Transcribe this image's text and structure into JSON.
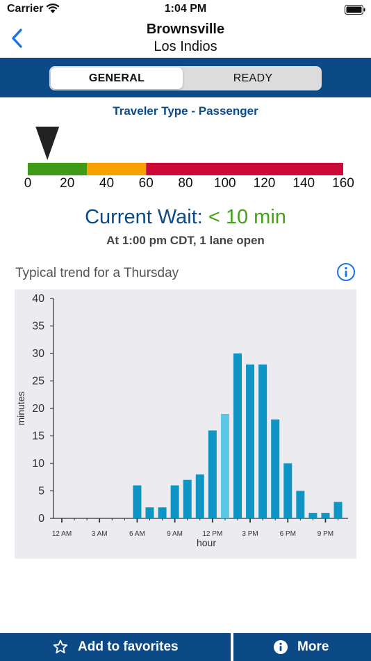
{
  "status_bar": {
    "carrier": "Carrier",
    "time": "1:04 PM"
  },
  "nav": {
    "title": "Brownsville",
    "subtitle": "Los Indios",
    "back_icon": "chevron-left-icon"
  },
  "tabs": [
    {
      "label": "GENERAL",
      "selected": true
    },
    {
      "label": "READY",
      "selected": false
    }
  ],
  "traveler_type": "Traveler Type - Passenger",
  "gauge": {
    "min": 0,
    "max": 160,
    "ticks": [
      "0",
      "20",
      "40",
      "60",
      "80",
      "100",
      "120",
      "140",
      "160"
    ],
    "pointer_value": 5,
    "segments": [
      {
        "from": 0,
        "to": 30,
        "color": "#3f9a17"
      },
      {
        "from": 30,
        "to": 60,
        "color": "#f7a100"
      },
      {
        "from": 60,
        "to": 160,
        "color": "#cc0a37"
      }
    ]
  },
  "current_wait": {
    "label": "Current Wait:",
    "value": "< 10 min"
  },
  "wait_detail": "At 1:00 pm CDT, 1 lane open",
  "trend_title": "Typical trend for a Thursday",
  "colors": {
    "brand": "#0c4a87",
    "bar": "#0f95c4",
    "bar_current": "#5bc6e6",
    "wait_value": "#43a219"
  },
  "chart_data": {
    "type": "bar",
    "xlabel": "hour",
    "ylabel": "minutes",
    "ylim": [
      0,
      40
    ],
    "yticks": [
      0,
      5,
      10,
      15,
      20,
      25,
      30,
      35,
      40
    ],
    "x_tick_labels": [
      {
        "hour": 0,
        "label": "12 AM"
      },
      {
        "hour": 3,
        "label": "3 AM"
      },
      {
        "hour": 6,
        "label": "6 AM"
      },
      {
        "hour": 9,
        "label": "9 AM"
      },
      {
        "hour": 12,
        "label": "12 PM"
      },
      {
        "hour": 15,
        "label": "3 PM"
      },
      {
        "hour": 18,
        "label": "6 PM"
      },
      {
        "hour": 21,
        "label": "9 PM"
      }
    ],
    "hours": [
      6,
      7,
      8,
      9,
      10,
      11,
      12,
      13,
      14,
      15,
      16,
      17,
      18,
      19,
      20,
      21,
      22
    ],
    "values": [
      6,
      2,
      2,
      6,
      7,
      8,
      16,
      19,
      30,
      28,
      28,
      18,
      10,
      5,
      1,
      1,
      3
    ],
    "highlight_hour": 13
  },
  "bottom": {
    "favorites_label": "Add to favorites",
    "favorites_icon": "star-icon",
    "more_label": "More",
    "more_icon": "info-icon"
  }
}
